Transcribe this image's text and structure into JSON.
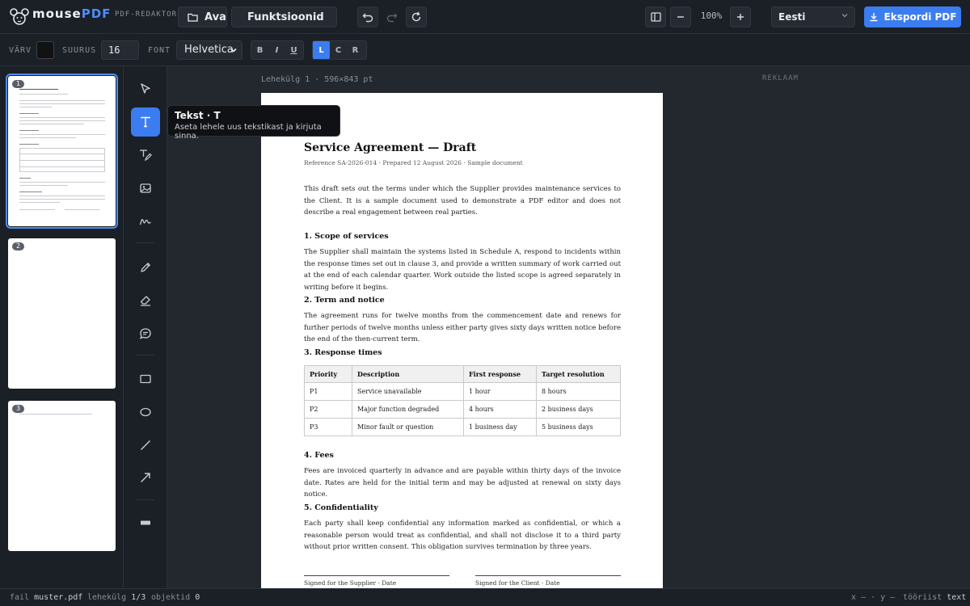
{
  "app": {
    "brand_main": "mouse",
    "brand_accent": "PDF",
    "subtitle": "PDF-REDAKTOR",
    "accent_color": "#3b7cf0"
  },
  "toolbar": {
    "open_label": "Ava",
    "functions_label": "Funktsioonid",
    "zoom": "100%",
    "language": "Eesti",
    "export_label": "Ekspordi PDF"
  },
  "format": {
    "color_label": "VÄRV",
    "color_value": "#111214",
    "size_label": "SUURUS",
    "size_value": "16",
    "font_label": "FONT",
    "font_value": "Helvetica",
    "bold": "B",
    "italic": "I",
    "underline": "U",
    "align_left": "L",
    "align_center": "C",
    "align_right": "R"
  },
  "thumbnails": [
    {
      "num": "1"
    },
    {
      "num": "2"
    },
    {
      "num": "3"
    }
  ],
  "tooltip": {
    "title": "Tekst · T",
    "text": "Aseta lehele uus tekstikast ja kirjuta sinna."
  },
  "canvas": {
    "page_info": "Lehekülg 1 · 596×843 pt",
    "ad_label": "REKLAAM"
  },
  "document": {
    "title": "Service Agreement — Draft",
    "reference": "Reference SA-2026-014 · Prepared 12 August 2026 · Sample document",
    "intro": "This draft sets out the terms under which the Supplier provides maintenance services to the Client. It is a sample document used to demonstrate a PDF editor and does not describe a real engagement between real parties.",
    "s1_heading": "1. Scope of services",
    "s1_text": "The Supplier shall maintain the systems listed in Schedule A, respond to incidents within the response times set out in clause 3, and provide a written summary of work carried out at the end of each calendar quarter. Work outside the listed scope is agreed separately in writing before it begins.",
    "s2_heading": "2. Term and notice",
    "s2_text": "The agreement runs for twelve months from the commencement date and renews for further periods of twelve months unless either party gives sixty days written notice before the end of the then-current term.",
    "s3_heading": "3. Response times",
    "table": {
      "headers": [
        "Priority",
        "Description",
        "First response",
        "Target resolution"
      ],
      "rows": [
        [
          "P1",
          "Service unavailable",
          "1 hour",
          "8 hours"
        ],
        [
          "P2",
          "Major function degraded",
          "4 hours",
          "2 business days"
        ],
        [
          "P3",
          "Minor fault or question",
          "1 business day",
          "5 business days"
        ]
      ]
    },
    "s4_heading": "4. Fees",
    "s4_text": "Fees are invoiced quarterly in advance and are payable within thirty days of the invoice date. Rates are held for the initial term and may be adjusted at renewal on sixty days notice.",
    "s5_heading": "5. Confidentiality",
    "s5_text": "Each party shall keep confidential any information marked as confidential, or which a reasonable person would treat as confidential, and shall not disclose it to a third party without prior written consent. This obligation survives termination by three years.",
    "sig_supplier": "Signed for the Supplier · Date",
    "sig_client": "Signed for the Client · Date"
  },
  "status": {
    "file_label": "fail",
    "file_value": "muster.pdf",
    "page_label": "lehekülg",
    "page_value": "1/3",
    "objects_label": "objektid",
    "objects_value": "0",
    "coords": "x — · y —",
    "tool_label": "tööriist",
    "tool_value": "text"
  }
}
